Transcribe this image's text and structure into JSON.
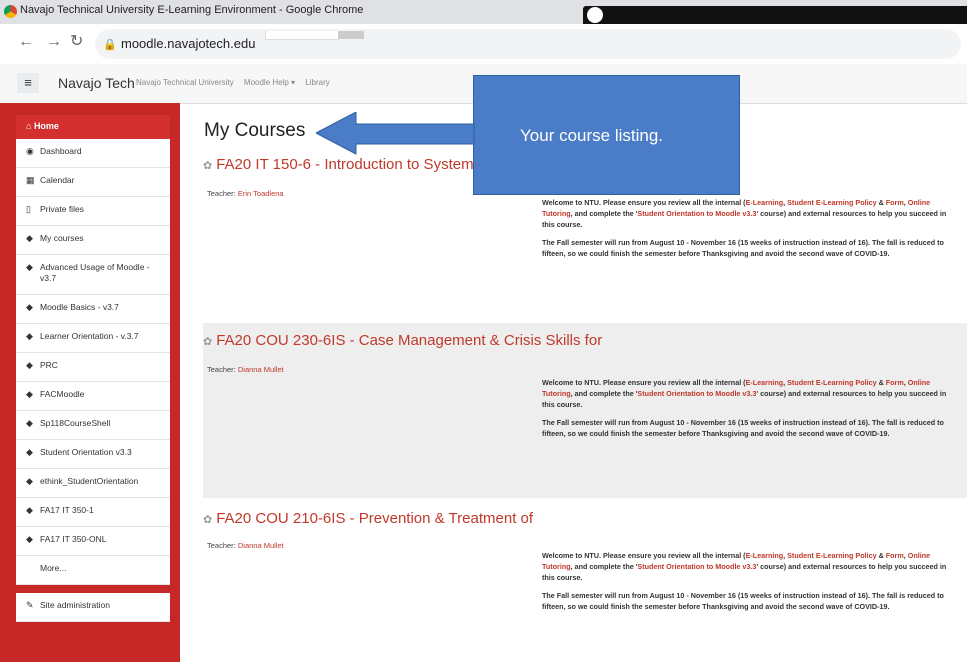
{
  "window": {
    "title": "Navajo Technical University E-Learning Environment - Google Chrome"
  },
  "browser": {
    "url": "moodle.navajotech.edu"
  },
  "navbar": {
    "brand": "Navajo Tech",
    "links": [
      "Navajo Technical University",
      "Moodle Help ▾",
      "Library"
    ]
  },
  "sidebar": {
    "home": "Home",
    "items": [
      {
        "label": "Dashboard",
        "icon": "dashboard-icon"
      },
      {
        "label": "Calendar",
        "icon": "calendar-icon"
      },
      {
        "label": "Private files",
        "icon": "file-icon"
      },
      {
        "label": "My courses",
        "icon": "graduation-cap-icon"
      },
      {
        "label": "Advanced Usage of Moodle - v3.7",
        "icon": "graduation-cap-icon"
      },
      {
        "label": "Moodle Basics - v3.7",
        "icon": "graduation-cap-icon"
      },
      {
        "label": "Learner Orientation - v.3.7",
        "icon": "graduation-cap-icon"
      },
      {
        "label": "PRC",
        "icon": "graduation-cap-icon"
      },
      {
        "label": "FACMoodle",
        "icon": "graduation-cap-icon"
      },
      {
        "label": "Sp118CourseShell",
        "icon": "graduation-cap-icon"
      },
      {
        "label": "Student Orientation v3.3",
        "icon": "graduation-cap-icon"
      },
      {
        "label": "ethink_StudentOrientation",
        "icon": "graduation-cap-icon"
      },
      {
        "label": "FA17 IT 350-1",
        "icon": "graduation-cap-icon"
      },
      {
        "label": "FA17 IT 350-ONL",
        "icon": "graduation-cap-icon"
      },
      {
        "label": "More...",
        "icon": ""
      }
    ],
    "admin": "Site administration"
  },
  "main": {
    "title": "My Courses",
    "callout": "Your course listing.",
    "courses": [
      {
        "title": "FA20 IT 150-6 - Introduction to System",
        "teacher_label": "Teacher:",
        "teacher": "Erin Toadlena"
      },
      {
        "title": "FA20 COU 230-6IS - Case Management & Crisis Skills for",
        "teacher_label": "Teacher:",
        "teacher": "Dianna Mullet"
      },
      {
        "title": "FA20 COU 210-6IS - Prevention & Treatment of",
        "teacher_label": "Teacher:",
        "teacher": "Dianna Mullet"
      }
    ],
    "summary": {
      "p1_a": "Welcome to NTU. Please ensure you review all the internal (",
      "link_elearning": "E-Learning",
      "sep1": ", ",
      "link_policy": "Student E-Learning Policy",
      "amp": " & ",
      "link_form": "Form",
      "sep2": ", ",
      "link_tutoring": "Online Tutoring",
      "p1_b": ",  and complete the '",
      "link_orientation": "Student Orientation to Moodle v3.3",
      "p1_c": "' course) and external resources to help you succeed in this course.",
      "p2": "The Fall semester will run from August 10 - November 16 (15 weeks of instruction instead of 16). The fall is reduced to fifteen, so we could finish the semester before Thanksgiving and avoid the second wave of COVID-19."
    }
  }
}
